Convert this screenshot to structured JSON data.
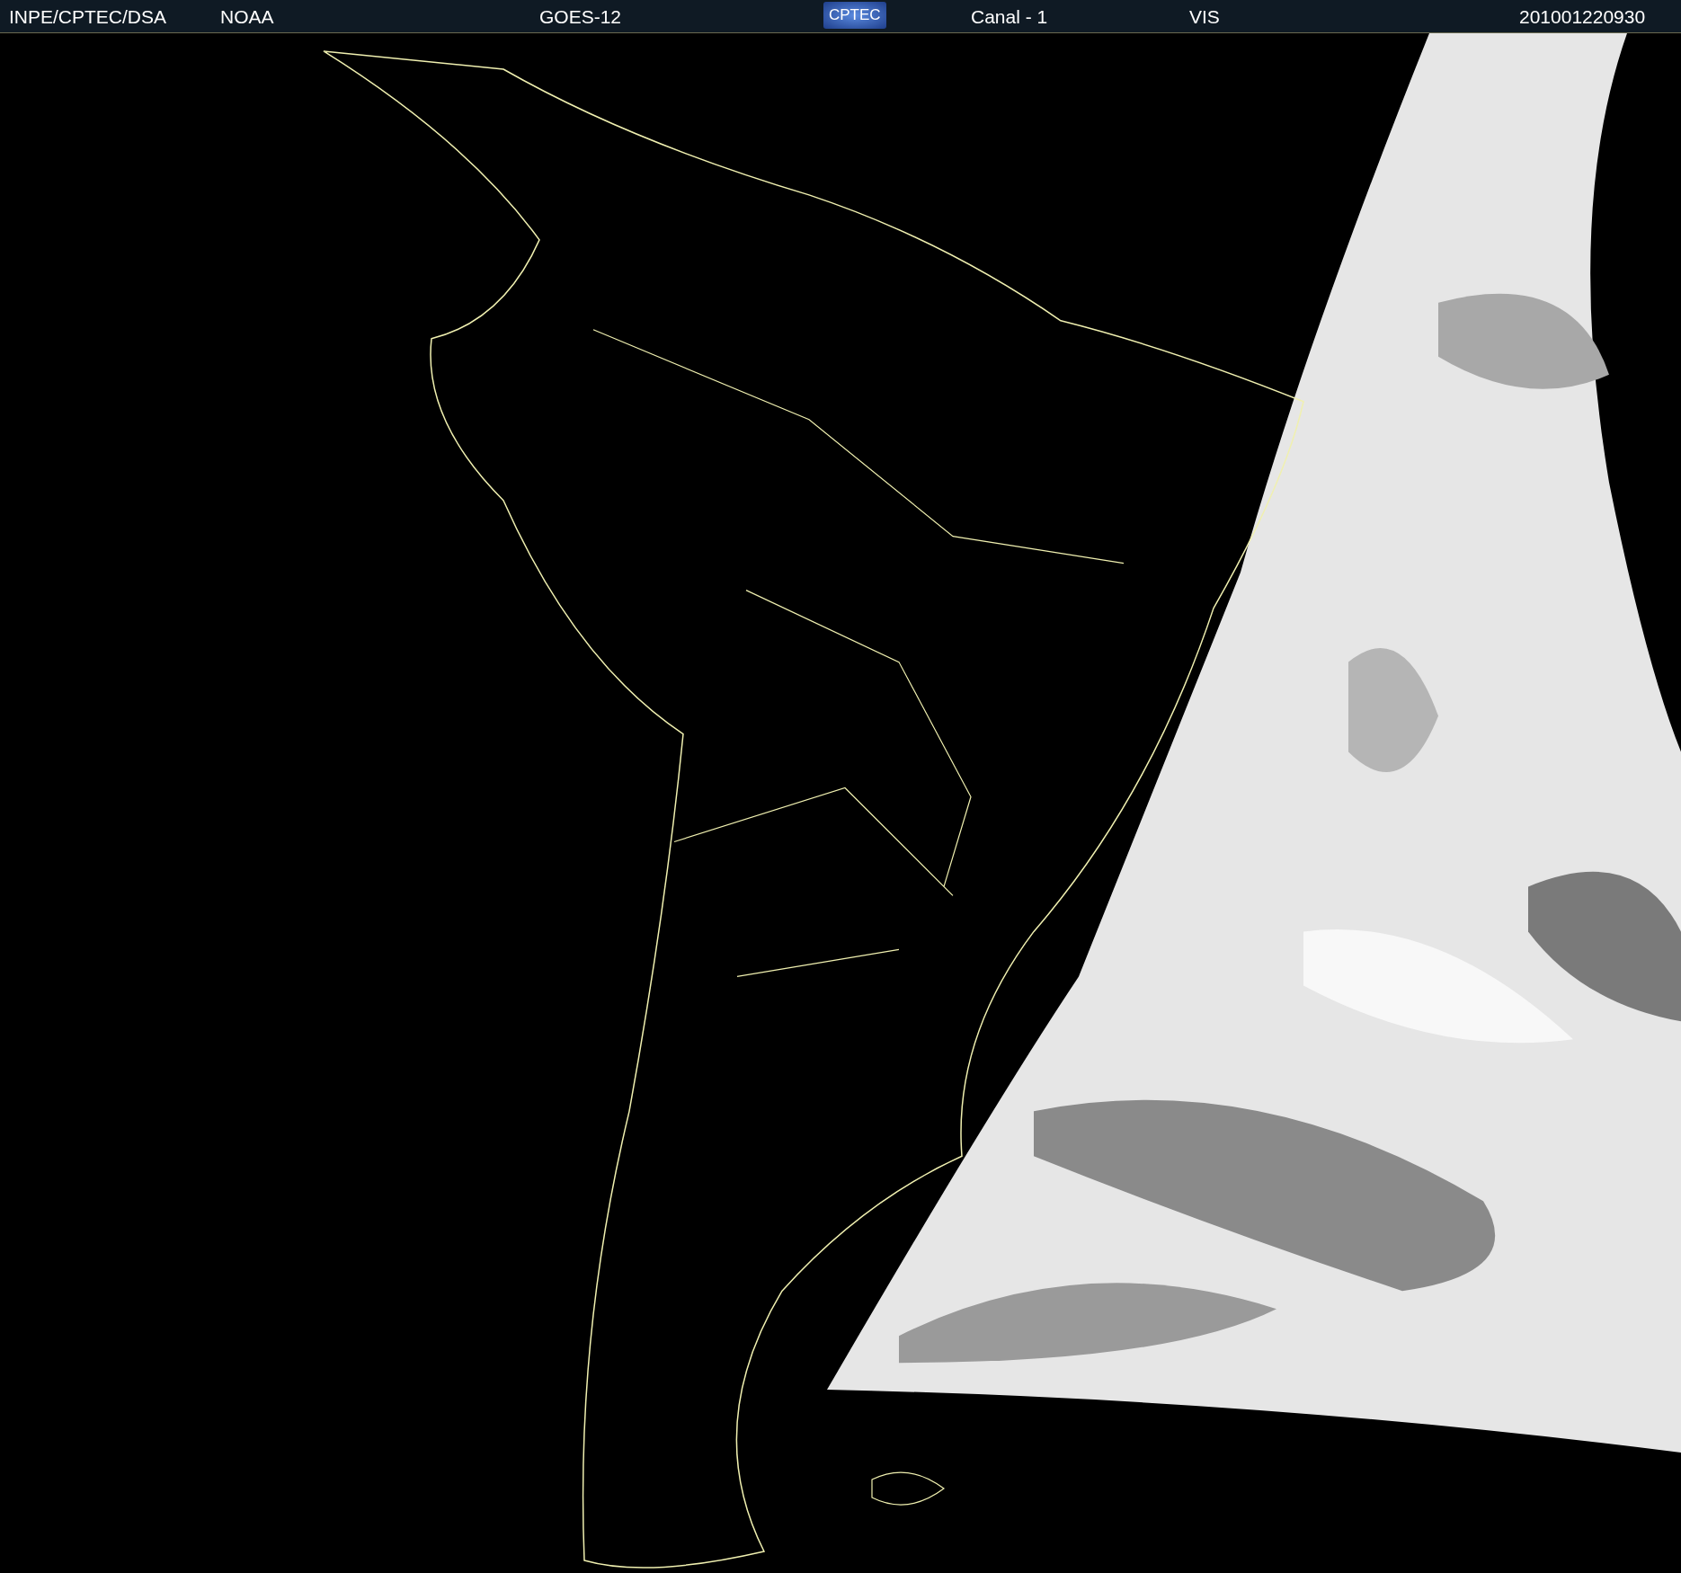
{
  "header": {
    "items": [
      {
        "kind": "text",
        "text": "INPE/CPTEC/DSA"
      },
      {
        "kind": "text",
        "text": "NOAA"
      },
      {
        "kind": "text",
        "text": "GOES-12"
      },
      {
        "kind": "logo",
        "text": "CPTEC"
      },
      {
        "kind": "text",
        "text": "Canal - 1"
      },
      {
        "kind": "text",
        "text": "VIS"
      },
      {
        "kind": "text",
        "text": "201001220930"
      }
    ]
  }
}
